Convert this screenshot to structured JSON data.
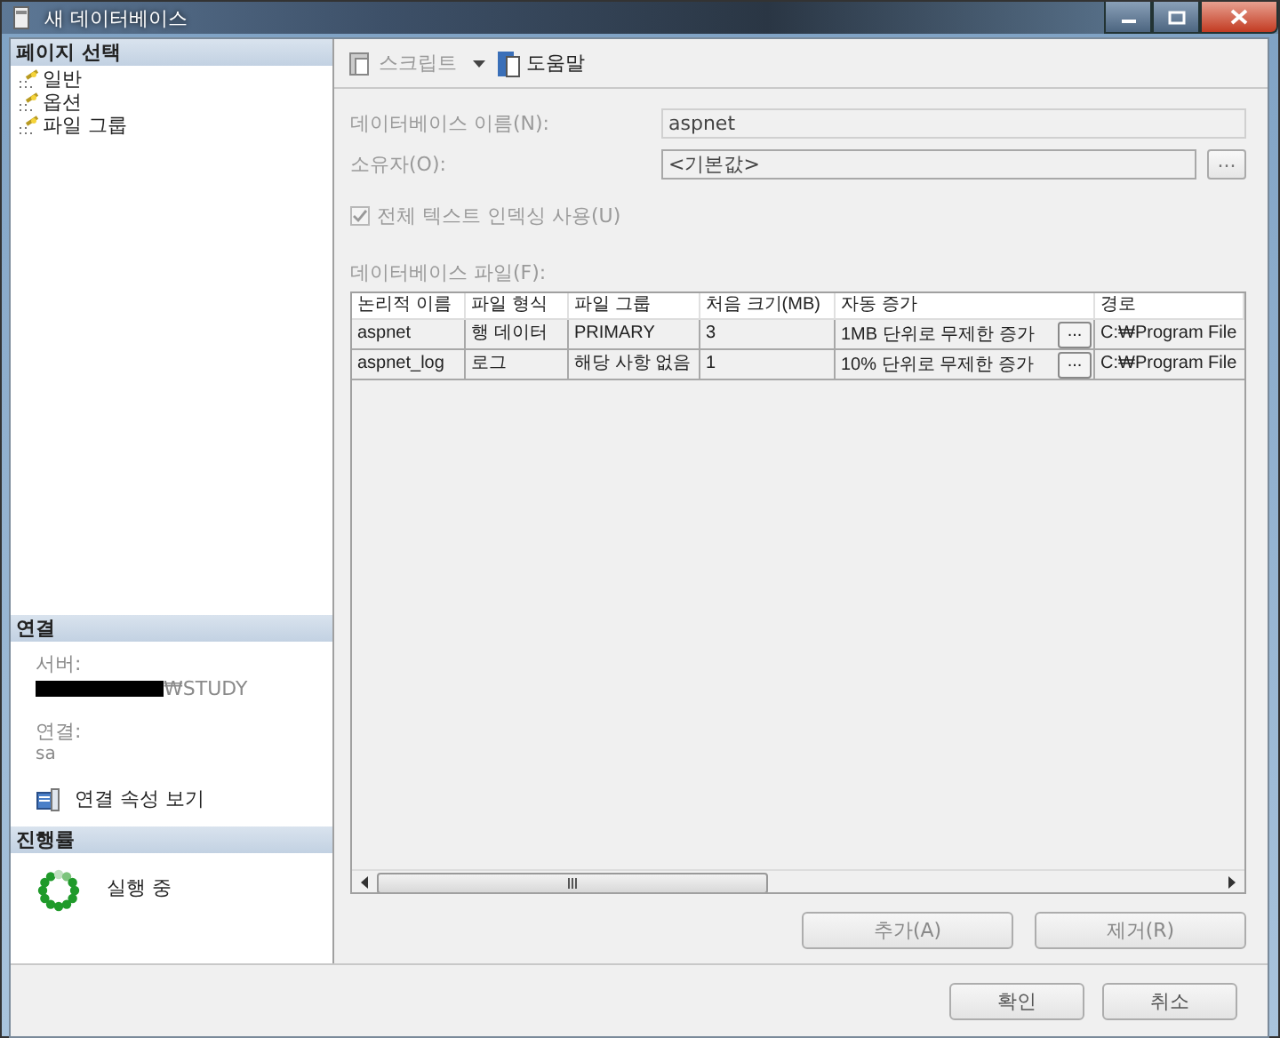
{
  "window": {
    "title": "새 데이터베이스"
  },
  "sidebar": {
    "heading": "페이지 선택",
    "items": [
      {
        "label": "일반"
      },
      {
        "label": "옵션"
      },
      {
        "label": "파일 그룹"
      }
    ]
  },
  "connection": {
    "heading": "연결",
    "server_label": "서버:",
    "server_value": "₩STUDY",
    "connection_label": "연결:",
    "connection_value": "sa",
    "link": "연결 속성 보기"
  },
  "progress": {
    "heading": "진행률",
    "status": "실행 중"
  },
  "toolbar": [
    {
      "kind": "script",
      "label": "스크립트",
      "disabled": true
    },
    {
      "kind": "help",
      "label": "도움말",
      "disabled": false
    }
  ],
  "form": {
    "disabled": true,
    "name_label": "데이터베이스 이름(N):",
    "name_value": "aspnet",
    "owner_label": "소유자(O):",
    "owner_value": "<기본값>",
    "owner_button": "...",
    "fulltext": {
      "label": "전체 텍스트 인덱싱 사용(U)",
      "checked": true
    },
    "files_label": "데이터베이스 파일(F):"
  },
  "table": {
    "columns": [
      "논리적 이름",
      "파일 형식",
      "파일 그룹",
      "처음 크기(MB)",
      "자동 증가",
      "경로"
    ],
    "rows": [
      {
        "cells": [
          "aspnet",
          "행 데이터",
          "PRIMARY",
          "3",
          "1MB 단위로 무제한 증가",
          "C:₩Program File"
        ],
        "button": "..."
      },
      {
        "cells": [
          "aspnet_log",
          "로그",
          "해당 사항 없음",
          "1",
          "10% 단위로 무제한 증가",
          "C:₩Program File"
        ],
        "button": "..."
      }
    ]
  },
  "grid_buttons": [
    "추가(A)",
    "제거(R)"
  ],
  "dialog_buttons": [
    "확인",
    "취소"
  ]
}
